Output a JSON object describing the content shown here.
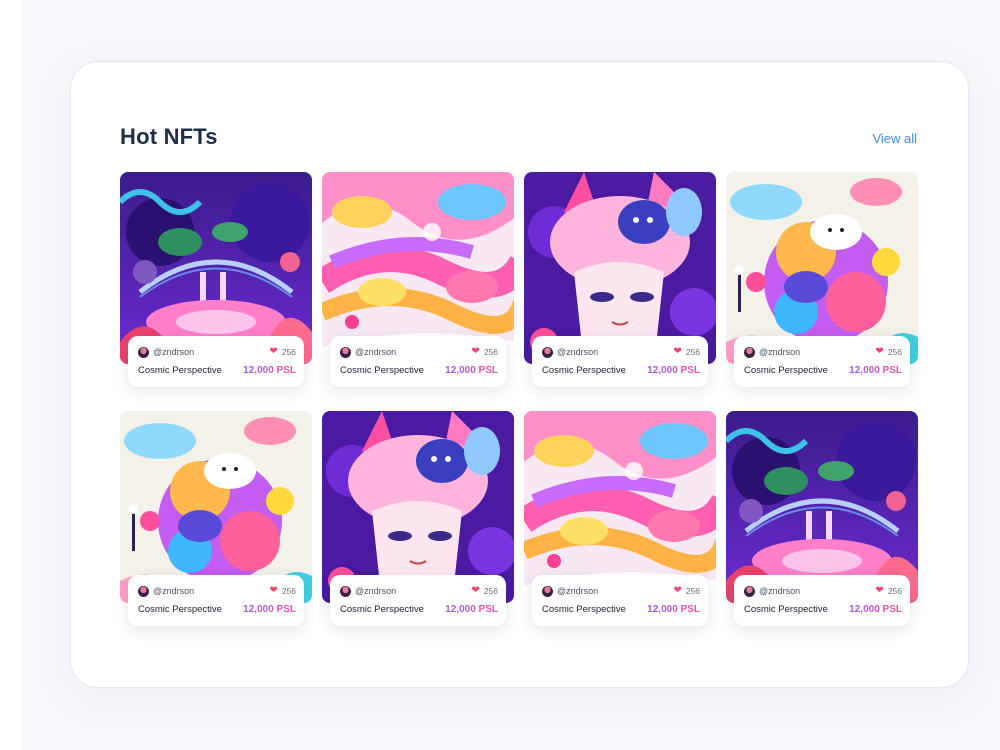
{
  "section": {
    "title": "Hot NFTs",
    "view_all_label": "View all"
  },
  "colors": {
    "accent_link": "#3a8ee6",
    "title": "#1f2d4b",
    "price_gradient": [
      "#9a5cf0",
      "#f44fa0"
    ],
    "heart": "#f0466d"
  },
  "cards": [
    {
      "art": "bridge",
      "creator": "@zndrson",
      "likes": "256",
      "name": "Cosmic Perspective",
      "price": "12,000",
      "currency": "PSL"
    },
    {
      "art": "swirl",
      "creator": "@zndrson",
      "likes": "256",
      "name": "Cosmic Perspective",
      "price": "12,000",
      "currency": "PSL"
    },
    {
      "art": "face",
      "creator": "@zndrson",
      "likes": "256",
      "name": "Cosmic Perspective",
      "price": "12,000",
      "currency": "PSL"
    },
    {
      "art": "blob",
      "creator": "@zndrson",
      "likes": "256",
      "name": "Cosmic Perspective",
      "price": "12,000",
      "currency": "PSL"
    },
    {
      "art": "blob",
      "creator": "@zndrson",
      "likes": "256",
      "name": "Cosmic Perspective",
      "price": "12,000",
      "currency": "PSL"
    },
    {
      "art": "face",
      "creator": "@zndrson",
      "likes": "256",
      "name": "Cosmic Perspective",
      "price": "12,000",
      "currency": "PSL"
    },
    {
      "art": "swirl",
      "creator": "@zndrson",
      "likes": "256",
      "name": "Cosmic Perspective",
      "price": "12,000",
      "currency": "PSL"
    },
    {
      "art": "bridge",
      "creator": "@zndrson",
      "likes": "256",
      "name": "Cosmic Perspective",
      "price": "12,000",
      "currency": "PSL"
    }
  ]
}
